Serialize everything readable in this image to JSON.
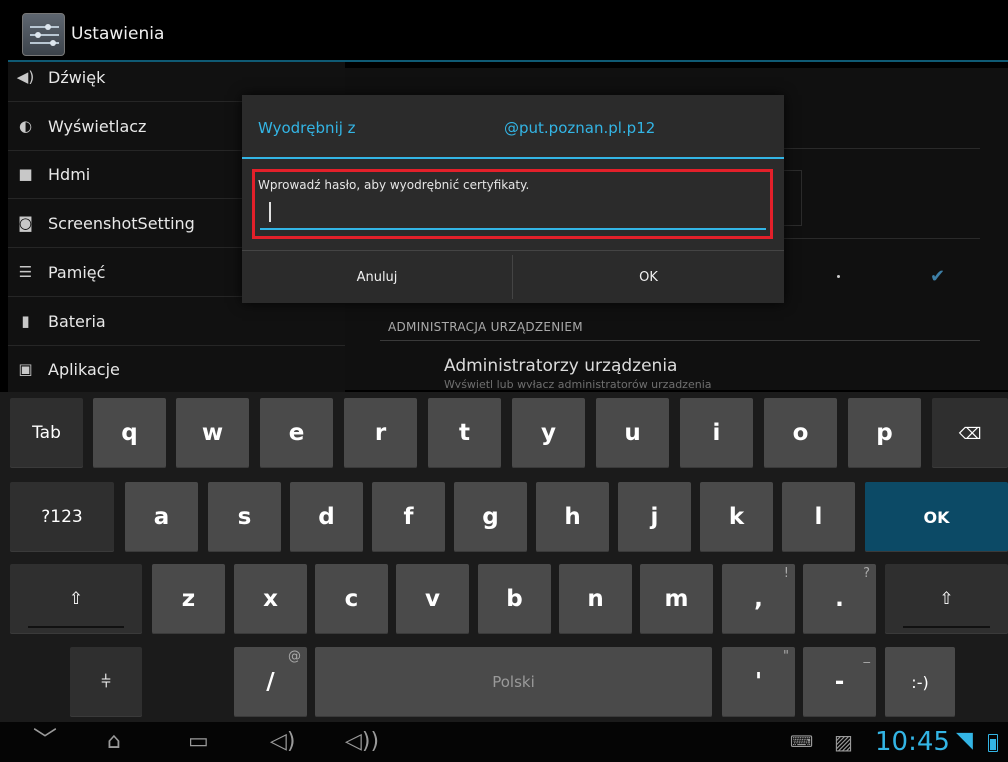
{
  "action_bar": {
    "title": "Ustawienia",
    "icon": "settings-sliders-icon"
  },
  "sidebar": {
    "items": [
      {
        "label": "Dźwięk",
        "icon": "speaker-icon"
      },
      {
        "label": "Wyświetlacz",
        "icon": "brightness-icon"
      },
      {
        "label": "Hdmi",
        "icon": "hdmi-icon"
      },
      {
        "label": "ScreenshotSetting",
        "icon": "camera-icon"
      },
      {
        "label": "Pamięć",
        "icon": "storage-icon"
      },
      {
        "label": "Bateria",
        "icon": "battery-icon"
      },
      {
        "label": "Aplikacje",
        "icon": "apps-icon"
      }
    ]
  },
  "detail": {
    "section_header": "ADMINISTRACJA URZĄDZENIEM",
    "device_admins": "Administratorzy urządzenia",
    "device_admins_sub": "Wyświetl lub wyłącz administratorów urządzenia"
  },
  "dialog": {
    "title_prefix": "Wyodrębnij z",
    "title_file": "@put.poznan.pl.p12",
    "message": "Wprowadź hasło, aby wyodrębnić certyfikaty.",
    "password_value": "",
    "cancel_label": "Anuluj",
    "ok_label": "OK",
    "highlight_color": "#e3202a",
    "accent_color": "#33b5e5"
  },
  "keyboard": {
    "row1": [
      "Tab",
      "q",
      "w",
      "e",
      "r",
      "t",
      "y",
      "u",
      "i",
      "o",
      "p"
    ],
    "row2": [
      "?123",
      "a",
      "s",
      "d",
      "f",
      "g",
      "h",
      "j",
      "k",
      "l",
      "OK"
    ],
    "row3": [
      "z",
      "x",
      "c",
      "v",
      "b",
      "n",
      "m",
      ",",
      "."
    ],
    "row3_hints": {
      "comma": "!",
      "period": "?"
    },
    "row4": {
      "slash": "/",
      "slash_hint": "@",
      "space": "Polski",
      "quote": "'",
      "quote_hint": "\"",
      "dash": "-",
      "dash_hint": "_",
      "smiley": ":-)"
    },
    "ok_color": "#0c4a66"
  },
  "status_bar": {
    "time": "10:45"
  }
}
